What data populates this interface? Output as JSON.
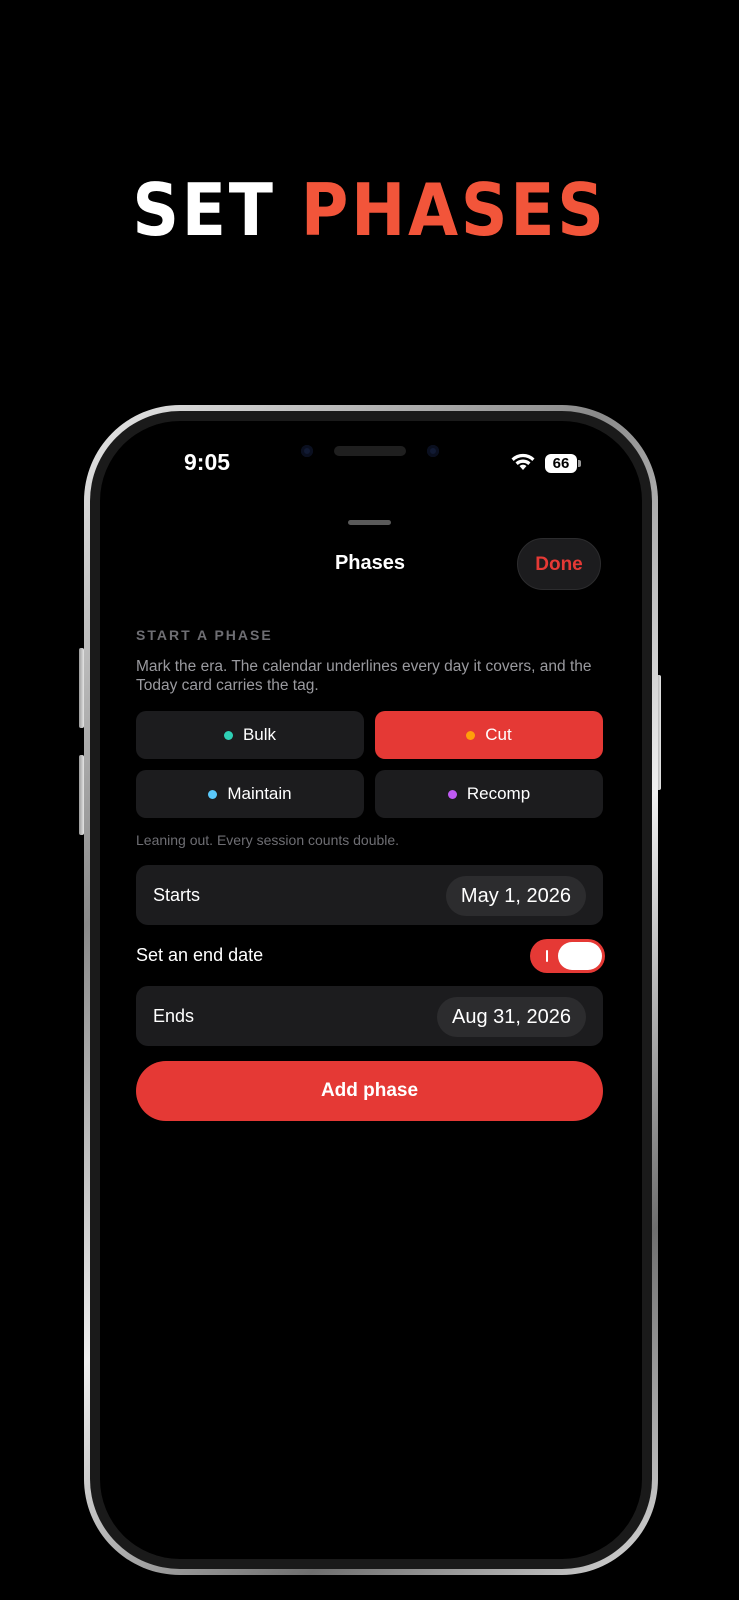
{
  "headline": {
    "word1": "SET",
    "word2": "PHASES",
    "accent_color": "#f2553a"
  },
  "status_bar": {
    "time": "9:05",
    "battery": "66",
    "wifi_icon": "wifi-icon"
  },
  "sheet": {
    "title": "Phases",
    "done_label": "Done"
  },
  "start_phase": {
    "section_label": "START A PHASE",
    "description": "Mark the era. The calendar underlines every day it covers, and the Today card carries the tag.",
    "phases": [
      {
        "label": "Bulk",
        "dot_color": "#2ecfb5",
        "selected": false
      },
      {
        "label": "Cut",
        "dot_color": "#ff9f0a",
        "selected": true
      },
      {
        "label": "Maintain",
        "dot_color": "#5ac8fa",
        "selected": false
      },
      {
        "label": "Recomp",
        "dot_color": "#bf5af2",
        "selected": false
      }
    ],
    "hint": "Leaning out. Every session counts double."
  },
  "starts": {
    "label": "Starts",
    "value": "May 1, 2026"
  },
  "end_date_toggle": {
    "label": "Set an end date",
    "on": true
  },
  "ends": {
    "label": "Ends",
    "value": "Aug 31, 2026"
  },
  "add_button": {
    "label": "Add phase"
  },
  "colors": {
    "accent": "#e53935",
    "card": "#1c1c1e",
    "background": "#000000"
  }
}
